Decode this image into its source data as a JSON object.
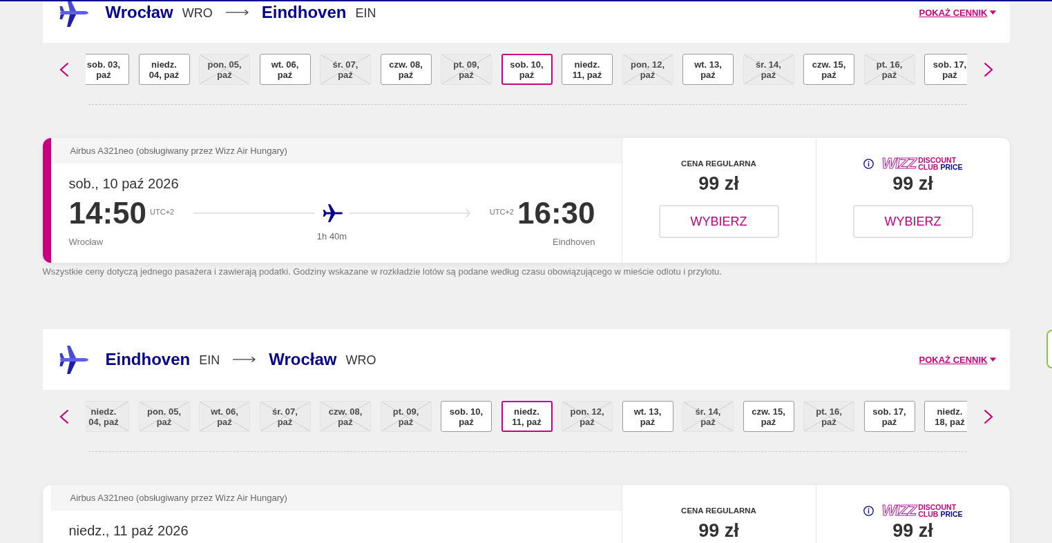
{
  "sections": [
    {
      "origin": {
        "city": "Wrocław",
        "code": "WRO"
      },
      "destination": {
        "city": "Eindhoven",
        "code": "EIN"
      },
      "price_list_link": "POKAŻ CENNIK",
      "dates": [
        {
          "label": "sob. 03, paź",
          "disabled": false,
          "selected": false
        },
        {
          "label": "niedz. 04, paź",
          "disabled": false,
          "selected": false
        },
        {
          "label": "pon. 05, paź",
          "disabled": true,
          "selected": false
        },
        {
          "label": "wt. 06, paź",
          "disabled": false,
          "selected": false
        },
        {
          "label": "śr. 07, paź",
          "disabled": true,
          "selected": false
        },
        {
          "label": "czw. 08, paź",
          "disabled": false,
          "selected": false
        },
        {
          "label": "pt. 09, paź",
          "disabled": true,
          "selected": false
        },
        {
          "label": "sob. 10, paź",
          "disabled": false,
          "selected": true
        },
        {
          "label": "niedz. 11, paź",
          "disabled": false,
          "selected": false
        },
        {
          "label": "pon. 12, paź",
          "disabled": true,
          "selected": false
        },
        {
          "label": "wt. 13, paź",
          "disabled": false,
          "selected": false
        },
        {
          "label": "śr. 14, paź",
          "disabled": true,
          "selected": false
        },
        {
          "label": "czw. 15, paź",
          "disabled": false,
          "selected": false
        },
        {
          "label": "pt. 16, paź",
          "disabled": true,
          "selected": false
        },
        {
          "label": "sob. 17, paź",
          "disabled": false,
          "selected": false
        }
      ],
      "flight": {
        "selected": true,
        "aircraft": "Airbus A321neo (obsługiwany przez Wizz Air Hungary)",
        "date": "sob., 10 paź 2026",
        "departure": {
          "time": "14:50",
          "utc": "UTC+2",
          "city": "Wrocław"
        },
        "arrival": {
          "time": "16:30",
          "utc": "UTC+2",
          "city": "Eindhoven"
        },
        "duration": "1h 40m",
        "fares": [
          {
            "kind": "regular",
            "label": "CENA REGULARNA",
            "price": "99 zł",
            "button": "WYBIERZ"
          },
          {
            "kind": "club",
            "logo": {
              "mark": "WIZZ",
              "lines": [
                "DISCOUNT",
                "CLUB"
              ],
              "accent": "PRICE"
            },
            "price": "99 zł",
            "button": "WYBIERZ"
          }
        ]
      },
      "note": "Wszystkie ceny dotyczą jednego pasażera i zawierają podatki. Godziny wskazane w rozkładzie lotów są podane według czasu obowiązującego w mieście odlotu i przylotu."
    },
    {
      "origin": {
        "city": "Eindhoven",
        "code": "EIN"
      },
      "destination": {
        "city": "Wrocław",
        "code": "WRO"
      },
      "price_list_link": "POKAŻ CENNIK",
      "dates": [
        {
          "label": "niedz. 04, paź",
          "disabled": true,
          "selected": false
        },
        {
          "label": "pon. 05, paź",
          "disabled": true,
          "selected": false
        },
        {
          "label": "wt. 06, paź",
          "disabled": true,
          "selected": false
        },
        {
          "label": "śr. 07, paź",
          "disabled": true,
          "selected": false
        },
        {
          "label": "czw. 08, paź",
          "disabled": true,
          "selected": false
        },
        {
          "label": "pt. 09, paź",
          "disabled": true,
          "selected": false
        },
        {
          "label": "sob. 10, paź",
          "disabled": false,
          "selected": false
        },
        {
          "label": "niedz. 11, paź",
          "disabled": false,
          "selected": true
        },
        {
          "label": "pon. 12, paź",
          "disabled": true,
          "selected": false
        },
        {
          "label": "wt. 13, paź",
          "disabled": false,
          "selected": false
        },
        {
          "label": "śr. 14, paź",
          "disabled": true,
          "selected": false
        },
        {
          "label": "czw. 15, paź",
          "disabled": false,
          "selected": false
        },
        {
          "label": "pt. 16, paź",
          "disabled": true,
          "selected": false
        },
        {
          "label": "sob. 17, paź",
          "disabled": false,
          "selected": false
        },
        {
          "label": "niedz. 18, paź",
          "disabled": false,
          "selected": false
        }
      ],
      "flight": {
        "selected": false,
        "aircraft": "Airbus A321neo (obsługiwany przez Wizz Air Hungary)",
        "date": "niedz., 11 paź 2026",
        "fares": [
          {
            "kind": "regular",
            "label": "CENA REGULARNA",
            "price": "99 zł"
          },
          {
            "kind": "club",
            "logo": {
              "mark": "WIZZ",
              "lines": [
                "DISCOUNT",
                "CLUB"
              ],
              "accent": "PRICE"
            },
            "price": "99 zł"
          }
        ]
      }
    }
  ]
}
